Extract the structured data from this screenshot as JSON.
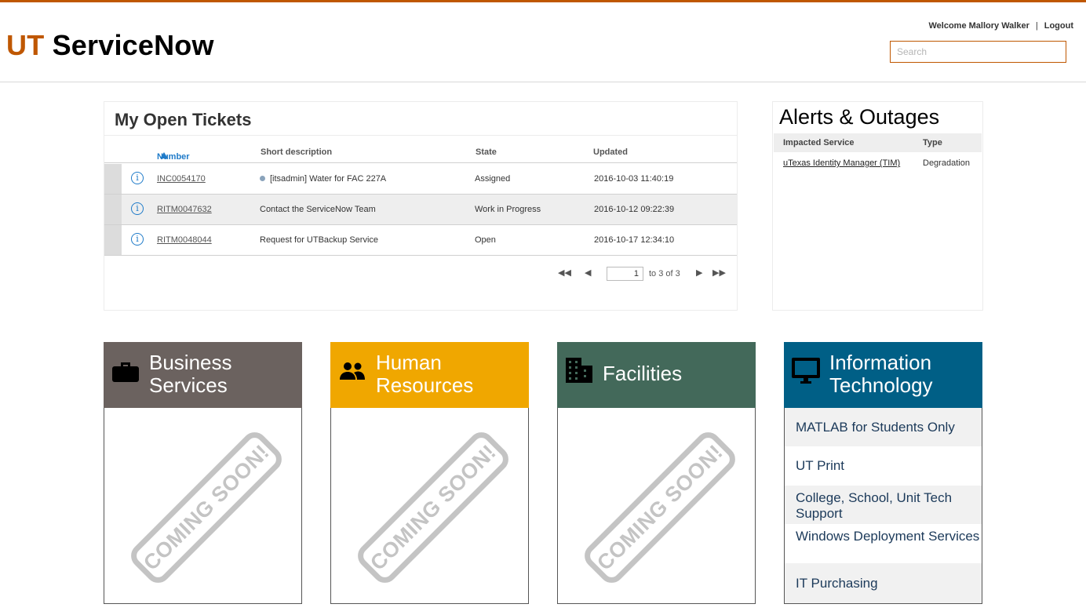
{
  "brand": {
    "prefix": "UT",
    "name": "ServiceNow"
  },
  "user": {
    "welcome": "Welcome Mallory Walker",
    "separator": "|",
    "logout": "Logout"
  },
  "search": {
    "placeholder": "Search",
    "value": ""
  },
  "tickets": {
    "title": "My Open Tickets",
    "columns": {
      "number": "Number",
      "short_description": "Short description",
      "state": "State",
      "updated": "Updated"
    },
    "sort": {
      "column": "Number",
      "direction": "ascending"
    },
    "rows": [
      {
        "number": "INC0054170",
        "short_description": "[itsadmin] Water for FAC 227A",
        "state": "Assigned",
        "updated": "2016-10-03 11:40:19",
        "has_dot": true
      },
      {
        "number": "RITM0047632",
        "short_description": "Contact the ServiceNow Team",
        "state": "Work in Progress",
        "updated": "2016-10-12 09:22:39",
        "has_dot": false
      },
      {
        "number": "RITM0048044",
        "short_description": "Request for UTBackup Service",
        "state": "Open",
        "updated": "2016-10-17 12:34:10",
        "has_dot": false
      }
    ],
    "pager": {
      "first": "◀◀",
      "prev": "◀",
      "page": "1",
      "of_text": "to 3 of 3",
      "next": "▶",
      "last": "▶▶"
    }
  },
  "alerts": {
    "title": "Alerts & Outages",
    "columns": {
      "service": "Impacted Service",
      "type": "Type"
    },
    "rows": [
      {
        "service": "uTexas Identity Manager (TIM)",
        "type": "Degradation"
      }
    ]
  },
  "cards": [
    {
      "title_line1": "Business",
      "title_line2": "Services",
      "color": "#6b625f",
      "icon": "briefcase-icon",
      "placeholder": "COMING SOON!"
    },
    {
      "title_line1": "Human",
      "title_line2": "Resources",
      "color": "#f0a700",
      "icon": "people-icon",
      "placeholder": "COMING SOON!"
    },
    {
      "title_line1": "Facilities",
      "color": "#43695a",
      "icon": "building-icon",
      "placeholder": "COMING SOON!"
    },
    {
      "title_line1": "Information",
      "title_line2": "Technology",
      "color": "#005f86",
      "icon": "monitor-icon",
      "items": [
        "MATLAB for Students Only",
        "UT Print",
        "College, School, Unit Tech Support",
        "Windows Deployment Services",
        "IT Purchasing"
      ]
    }
  ],
  "colors": {
    "accent": "#bf5700",
    "link": "#1f7bc9"
  }
}
